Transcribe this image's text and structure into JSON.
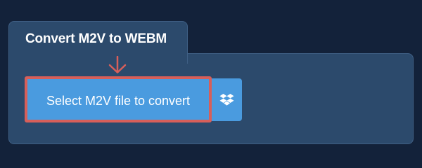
{
  "converter": {
    "title": "Convert M2V to WEBM",
    "select_label": "Select M2V file to convert",
    "dropbox_icon": "dropbox-icon",
    "arrow_icon": "arrow-down-icon"
  },
  "colors": {
    "page_background": "#13223a",
    "panel_background": "#2c4a6c",
    "button_blue": "#4a9bdf",
    "highlight_red": "#d75f5a"
  }
}
